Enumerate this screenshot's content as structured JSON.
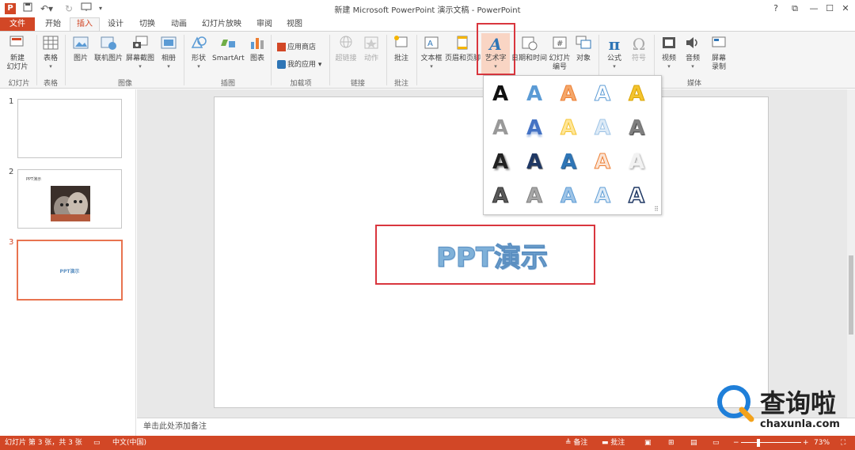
{
  "titlebar": {
    "logo": "P",
    "title": "新建 Microsoft PowerPoint 演示文稿 - PowerPoint",
    "help": "?",
    "restore": "⧉",
    "minimize": "—",
    "maximize": "☐",
    "close": "✕"
  },
  "tabs": [
    "文件",
    "开始",
    "插入",
    "设计",
    "切换",
    "动画",
    "幻灯片放映",
    "审阅",
    "视图"
  ],
  "ribbon": {
    "new_slide": "新建\n幻灯片",
    "table": "表格",
    "picture": "图片",
    "online_picture": "联机图片",
    "screenshot": "屏幕截图",
    "album": "相册",
    "shapes": "形状",
    "smartart": "SmartArt",
    "chart": "图表",
    "app_store": "应用商店",
    "my_apps": "我的应用",
    "hyperlink": "超链接",
    "action": "动作",
    "comment": "批注",
    "textbox": "文本框",
    "header_footer": "页眉和页脚",
    "wordart": "艺术字",
    "datetime": "日期和时间",
    "slide_number_1": "幻灯片",
    "slide_number_2": "编号",
    "object": "对象",
    "equation": "公式",
    "symbol": "符号",
    "video": "视频",
    "audio": "音频",
    "screen_rec_1": "屏幕",
    "screen_rec_2": "录制",
    "groups": {
      "slides": "幻灯片",
      "tables": "表格",
      "images": "图像",
      "illustrations": "插图",
      "addins": "加载项",
      "links": "链接",
      "comments": "批注",
      "media": "媒体"
    }
  },
  "slides": [
    {
      "num": "1"
    },
    {
      "num": "2",
      "title": "PPT演示"
    },
    {
      "num": "3",
      "title": "PPT演示"
    }
  ],
  "slide": {
    "wordart_text": "PPT演示"
  },
  "notes_placeholder": "单击此处添加备注",
  "gallery": {
    "glyph": "A"
  },
  "status": {
    "slide_info": "幻灯片 第 3 张，共 3 张",
    "language": "中文(中国)",
    "notes": "备注",
    "comments": "批注",
    "zoom": "73%"
  },
  "watermark": {
    "brand": "查询啦",
    "url": "chaxunla.com"
  },
  "colors": {
    "accent": "#d24726",
    "highlight": "#d9363e",
    "wordart": "#7fb1d9"
  }
}
